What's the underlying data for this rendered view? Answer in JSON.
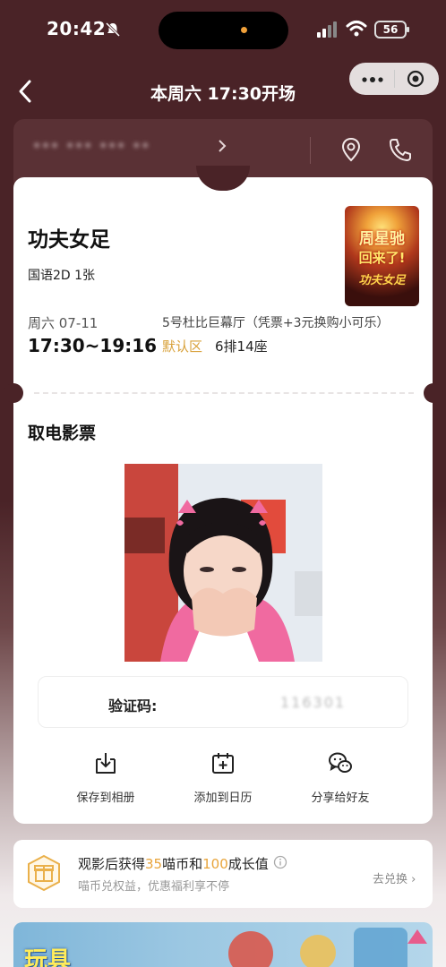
{
  "status_bar": {
    "time": "20:42",
    "battery": "56"
  },
  "nav": {
    "title": "本周六 17:30开场"
  },
  "cinema": {
    "name": "*** *** *** **"
  },
  "movie": {
    "title": "功夫女足",
    "meta": "国语2D 1张",
    "poster_lines": [
      "周星驰",
      "回来了!",
      "功夫女足"
    ]
  },
  "schedule": {
    "date": "周六 07-11",
    "showtime": "17:30~19:16",
    "hall": "5号杜比巨幕厅（凭票+3元换购小可乐）",
    "area": "默认区",
    "seat": "6排14座"
  },
  "pickup": {
    "title": "取电影票",
    "code_label": "验证码:",
    "code_value": "116301"
  },
  "actions": [
    {
      "label": "保存到相册",
      "icon": "download-icon"
    },
    {
      "label": "添加到日历",
      "icon": "calendar-add-icon"
    },
    {
      "label": "分享给好友",
      "icon": "wechat-icon"
    }
  ],
  "reward": {
    "title_pre": "观影后获得",
    "coins": "35",
    "title_mid": "喵币和",
    "growth": "100",
    "title_post": "成长值",
    "subtitle": "喵币兑权益，优惠福利享不停",
    "exchange": "去兑换",
    "icon": "gift-icon"
  },
  "banner": {
    "text": "玩具"
  },
  "colors": {
    "background": "#4a2327",
    "accent": "#e8a43a",
    "area": "#d8a13a"
  }
}
